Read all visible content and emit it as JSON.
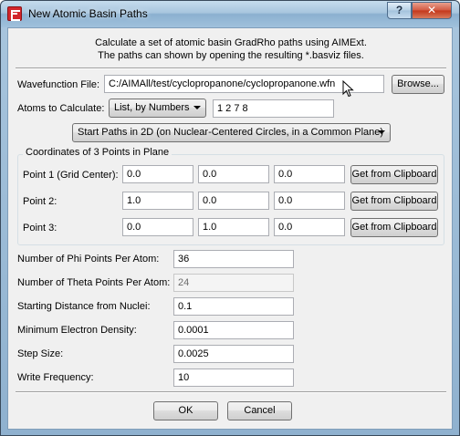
{
  "window": {
    "title": "New Atomic Basin Paths",
    "help_glyph": "?",
    "close_glyph": "✕"
  },
  "description": {
    "line1": "Calculate a set of atomic basin GradRho paths using AIMExt.",
    "line2": "The paths can shown by opening the resulting *.basviz files."
  },
  "wavefunction": {
    "label": "Wavefunction File:",
    "value": "C:/AIMAll/test/cyclopropanone/cyclopropanone.wfn",
    "browse_label": "Browse..."
  },
  "atoms": {
    "label": "Atoms to Calculate:",
    "mode_selected": "List, by Numbers",
    "value": "1 2 7 8"
  },
  "start_paths": {
    "selected": "Start Paths in 2D (on Nuclear-Centered Circles, in a Common Plane)"
  },
  "plane": {
    "title": "Coordinates of 3 Points in Plane",
    "clipboard_label": "Get from Clipboard",
    "points": [
      {
        "label": "Point 1 (Grid Center):",
        "x": "0.0",
        "y": "0.0",
        "z": "0.0"
      },
      {
        "label": "Point 2:",
        "x": "1.0",
        "y": "0.0",
        "z": "0.0"
      },
      {
        "label": "Point 3:",
        "x": "0.0",
        "y": "1.0",
        "z": "0.0"
      }
    ]
  },
  "params": [
    {
      "label": "Number of Phi Points Per Atom:",
      "value": "36",
      "disabled": false
    },
    {
      "label": "Number of Theta Points Per Atom:",
      "value": "24",
      "disabled": true
    },
    {
      "label": "Starting Distance from Nuclei:",
      "value": "0.1",
      "disabled": false
    },
    {
      "label": "Minimum Electron Density:",
      "value": "0.0001",
      "disabled": false
    },
    {
      "label": "Step Size:",
      "value": "0.0025",
      "disabled": false
    },
    {
      "label": "Write Frequency:",
      "value": "10",
      "disabled": false
    }
  ],
  "footer": {
    "ok_label": "OK",
    "cancel_label": "Cancel"
  }
}
